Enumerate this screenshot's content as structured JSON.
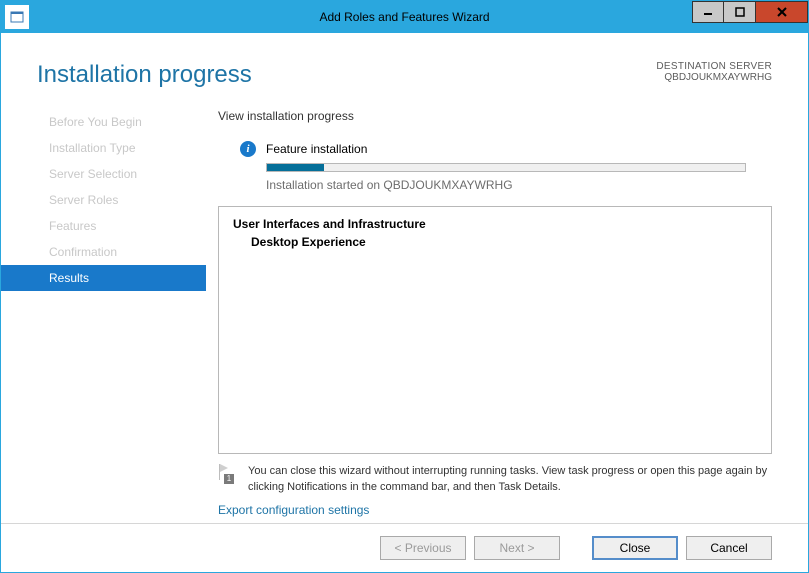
{
  "titlebar": {
    "title": "Add Roles and Features Wizard"
  },
  "window_controls": {
    "minimize": "—",
    "maximize": "▢",
    "close": "✕"
  },
  "header": {
    "page_title": "Installation progress",
    "destination_label": "DESTINATION SERVER",
    "destination_value": "QBDJOUKMXAYWRHG"
  },
  "sidebar": {
    "steps": [
      "Before You Begin",
      "Installation Type",
      "Server Selection",
      "Server Roles",
      "Features",
      "Confirmation",
      "Results"
    ],
    "active_index": 6
  },
  "main": {
    "view_label": "View installation progress",
    "status_text": "Feature installation",
    "started_on": "Installation started on QBDJOUKMXAYWRHG",
    "progress_percent": 12,
    "results": {
      "group": "User Interfaces and Infrastructure",
      "item": "Desktop Experience"
    },
    "tip_text": "You can close this wizard without interrupting running tasks. View task progress or open this page again by clicking Notifications in the command bar, and then Task Details.",
    "flag_badge": "1",
    "export_link": "Export configuration settings"
  },
  "footer": {
    "previous": "< Previous",
    "next": "Next >",
    "close": "Close",
    "cancel": "Cancel"
  }
}
